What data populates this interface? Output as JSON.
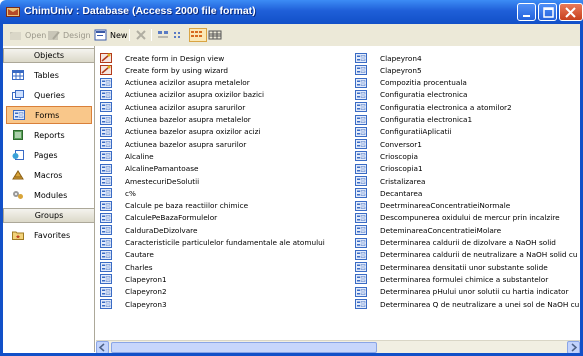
{
  "window": {
    "title": "ChimUniv : Database (Access 2000 file format)",
    "accent": "#1250c8"
  },
  "toolbar": {
    "open_label": "Open",
    "design_label": "Design",
    "new_label": "New"
  },
  "objects_bar": {
    "objects_header": "Objects",
    "groups_header": "Groups",
    "items": [
      {
        "label": "Tables",
        "icon": "table-icon"
      },
      {
        "label": "Queries",
        "icon": "query-icon"
      },
      {
        "label": "Forms",
        "icon": "form-icon",
        "selected": true
      },
      {
        "label": "Reports",
        "icon": "report-icon"
      },
      {
        "label": "Pages",
        "icon": "page-icon"
      },
      {
        "label": "Macros",
        "icon": "macro-icon"
      },
      {
        "label": "Modules",
        "icon": "module-icon"
      }
    ],
    "favorites_label": "Favorites"
  },
  "list": {
    "column1": [
      {
        "label": "Create form in Design view",
        "icon": "wizard-icon"
      },
      {
        "label": "Create form by using wizard",
        "icon": "wizard-icon"
      },
      {
        "label": "Actiunea acizilor asupra metalelor",
        "icon": "form-icon"
      },
      {
        "label": "Actiunea acizilor asupra oxizilor bazici",
        "icon": "form-icon"
      },
      {
        "label": "Actiunea acizilor asupra sarurilor",
        "icon": "form-icon"
      },
      {
        "label": "Actiunea bazelor asupra metalelor",
        "icon": "form-icon"
      },
      {
        "label": "Actiunea bazelor asupra oxizilor acizi",
        "icon": "form-icon"
      },
      {
        "label": "Actiunea bazelor asupra sarurilor",
        "icon": "form-icon"
      },
      {
        "label": "Alcaline",
        "icon": "form-icon"
      },
      {
        "label": "AlcalinePamantoase",
        "icon": "form-icon"
      },
      {
        "label": "AmestecuriDeSolutii",
        "icon": "form-icon"
      },
      {
        "label": "c%",
        "icon": "form-icon"
      },
      {
        "label": "Calcule pe baza reactiilor chimice",
        "icon": "form-icon"
      },
      {
        "label": "CalculePeBazaFormulelor",
        "icon": "form-icon"
      },
      {
        "label": "CalduraDeDizolvare",
        "icon": "form-icon"
      },
      {
        "label": "Caracteristicile particulelor fundamentale ale atomului",
        "icon": "form-icon"
      },
      {
        "label": "Cautare",
        "icon": "form-icon"
      },
      {
        "label": "Charles",
        "icon": "form-icon"
      },
      {
        "label": "Clapeyron1",
        "icon": "form-icon"
      },
      {
        "label": "Clapeyron2",
        "icon": "form-icon"
      },
      {
        "label": "Clapeyron3",
        "icon": "form-icon"
      }
    ],
    "column2": [
      {
        "label": "Clapeyron4",
        "icon": "form-icon"
      },
      {
        "label": "Clapeyron5",
        "icon": "form-icon"
      },
      {
        "label": "Compozitia procentuala",
        "icon": "form-icon"
      },
      {
        "label": "Configuratia electronica",
        "icon": "form-icon"
      },
      {
        "label": "Configuratia electronica a atomilor2",
        "icon": "form-icon"
      },
      {
        "label": "Configuratia electronica1",
        "icon": "form-icon"
      },
      {
        "label": "ConfiguratiiAplicatii",
        "icon": "form-icon"
      },
      {
        "label": "Conversor1",
        "icon": "form-icon"
      },
      {
        "label": "Crioscopia",
        "icon": "form-icon"
      },
      {
        "label": "Crioscopia1",
        "icon": "form-icon"
      },
      {
        "label": "Cristalizarea",
        "icon": "form-icon"
      },
      {
        "label": "Decantarea",
        "icon": "form-icon"
      },
      {
        "label": "DeetrminareaConcentratieiNormale",
        "icon": "form-icon"
      },
      {
        "label": "Descompunerea oxidului de mercur prin incalzire",
        "icon": "form-icon"
      },
      {
        "label": "DeteminareaConcentratieiMolare",
        "icon": "form-icon"
      },
      {
        "label": "Determinarea caldurii de dizolvare a NaOH solid",
        "icon": "form-icon"
      },
      {
        "label": "Determinarea caldurii de neutralizare a NaOH solid cu HCl",
        "icon": "form-icon"
      },
      {
        "label": "Determinarea densitatii unor substante solide",
        "icon": "form-icon"
      },
      {
        "label": "Determinarea formulei chimice a substantelor",
        "icon": "form-icon"
      },
      {
        "label": "Determinarea pHului unor solutii cu hartia indicator",
        "icon": "form-icon"
      },
      {
        "label": "Determinarea Q de neutralizare a unei sol de NaOH cu HCl",
        "icon": "form-icon"
      }
    ]
  }
}
